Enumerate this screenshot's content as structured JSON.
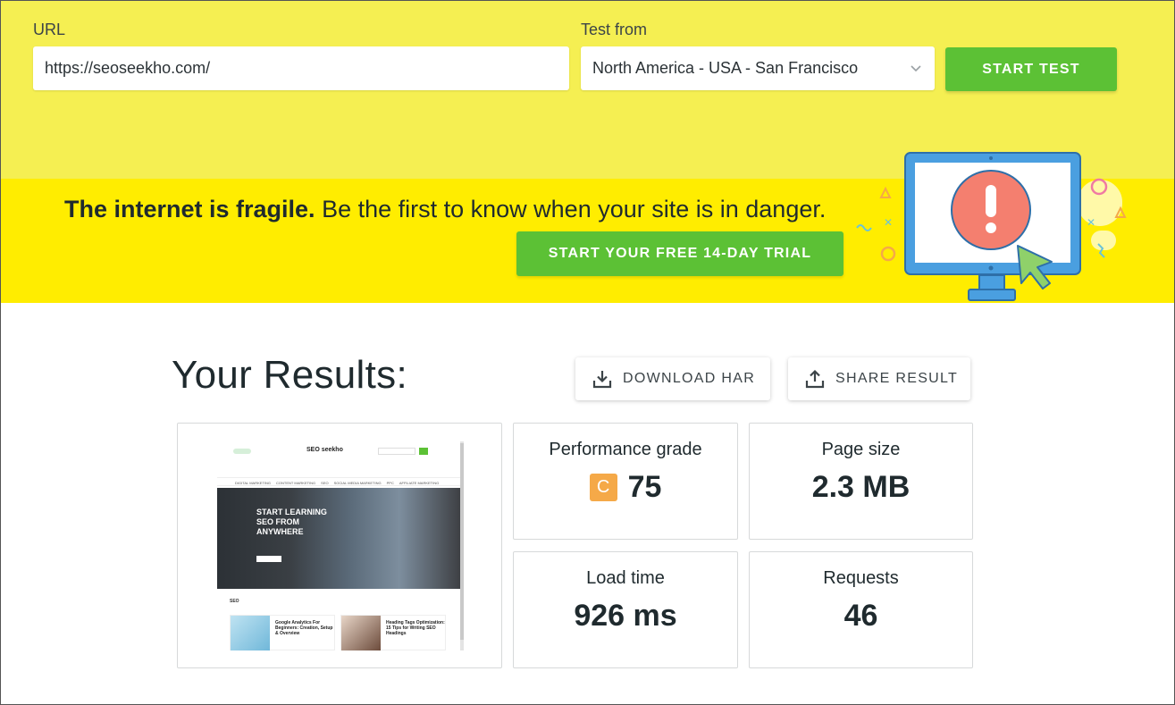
{
  "form": {
    "url_label": "URL",
    "url_value": "https://seoseekho.com/",
    "test_from_label": "Test from",
    "test_from_value": "North America - USA - San Francisco",
    "start_label": "START TEST"
  },
  "banner": {
    "headline_bold": "The internet is fragile.",
    "headline_rest": " Be the first to know when your site is in danger.",
    "trial_label": "START YOUR FREE 14-DAY TRIAL"
  },
  "results": {
    "title": "Your Results:",
    "download_label": "DOWNLOAD HAR",
    "share_label": "SHARE RESULT",
    "metrics": {
      "performance": {
        "label": "Performance grade",
        "grade": "C",
        "value": "75"
      },
      "page_size": {
        "label": "Page size",
        "value": "2.3 MB"
      },
      "load_time": {
        "label": "Load time",
        "value": "926 ms"
      },
      "requests": {
        "label": "Requests",
        "value": "46"
      }
    }
  },
  "thumbnail": {
    "logo": "SEO seekho",
    "hero_text": "START LEARNING SEO FROM ANYWHERE",
    "section": "SEO",
    "menu": [
      "DIGITAL MARKETING",
      "CONTENT MARKETING",
      "SEO",
      "SOCIAL MEDIA MARKETING",
      "PPC",
      "AFFILIATE MARKETING"
    ],
    "posts": [
      "Google Analytics For Beginners: Creation, Setup & Overview",
      "Heading Tags Optimization: 15 Tips for Writing SEO Headings"
    ]
  },
  "colors": {
    "top_bg": "#f5ef52",
    "banner_bg": "#ffed00",
    "green": "#5cc135",
    "grade_orange": "#f5a948"
  }
}
